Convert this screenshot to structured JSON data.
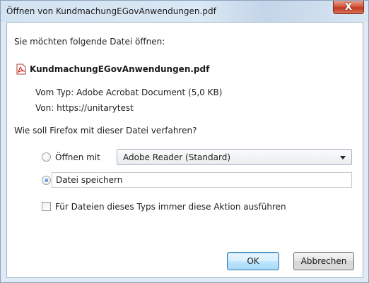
{
  "window": {
    "title": "Öffnen von KundmachungEGovAnwendungen.pdf",
    "close_label": "X"
  },
  "dialog": {
    "prompt": "Sie möchten folgende Datei öffnen:",
    "file": {
      "icon": "pdf-file-icon",
      "name": "KundmachungEGovAnwendungen.pdf",
      "type_line": "Vom Typ: Adobe Acrobat Document (5,0 KB)",
      "from_line": "Von: https://unitarytest"
    },
    "question": "Wie soll Firefox mit dieser Datei verfahren?",
    "options": {
      "open_with": {
        "label": "Öffnen mit",
        "selected": false,
        "app_value": "Adobe Reader (Standard)"
      },
      "save_file": {
        "label": "Datei speichern",
        "selected": true
      }
    },
    "always_checkbox": {
      "label": "Für Dateien dieses Typs immer diese Aktion ausführen",
      "checked": false
    },
    "buttons": {
      "ok": "OK",
      "cancel": "Abbrechen"
    }
  }
}
